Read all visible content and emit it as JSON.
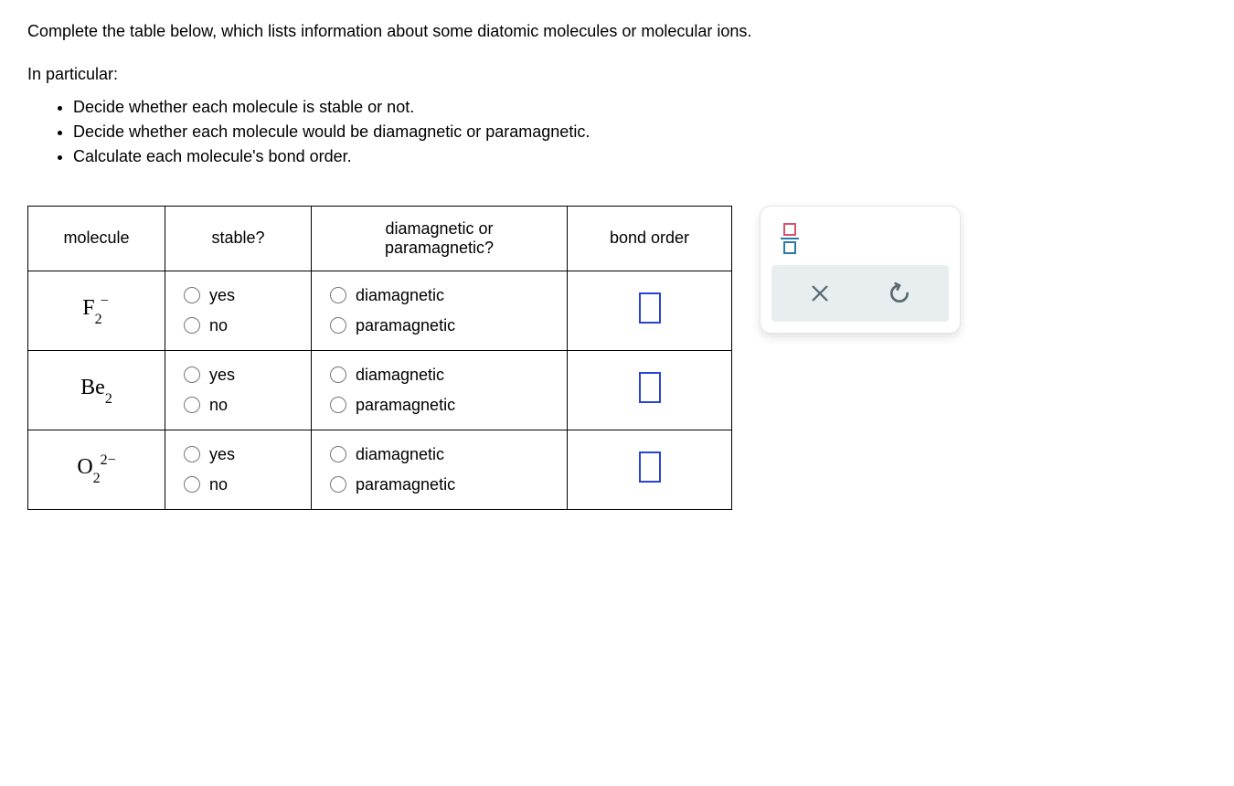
{
  "instructions": {
    "intro": "Complete the table below, which lists information about some diatomic molecules or molecular ions.",
    "lead": "In particular:",
    "bullets": [
      "Decide whether each molecule is stable or not.",
      "Decide whether each molecule would be diamagnetic or paramagnetic.",
      "Calculate each molecule's bond order."
    ]
  },
  "table": {
    "headers": {
      "molecule": "molecule",
      "stable": "stable?",
      "magnetism": "diamagnetic or paramagnetic?",
      "bondorder": "bond order"
    },
    "options": {
      "yes": "yes",
      "no": "no",
      "diamagnetic": "diamagnetic",
      "paramagnetic": "paramagnetic"
    },
    "rows": [
      {
        "id": "f2minus",
        "base": "F",
        "sub": "2",
        "sup": "−",
        "sup_before": false
      },
      {
        "id": "be2",
        "base": "Be",
        "sub": "2",
        "sup": "",
        "sup_before": false
      },
      {
        "id": "o2_2minus",
        "base": "O",
        "sub": "2",
        "sup": "2−",
        "sup_before": true
      }
    ]
  },
  "toolbox": {
    "fraction": "fraction-tool",
    "clear": "clear",
    "reset": "reset"
  }
}
